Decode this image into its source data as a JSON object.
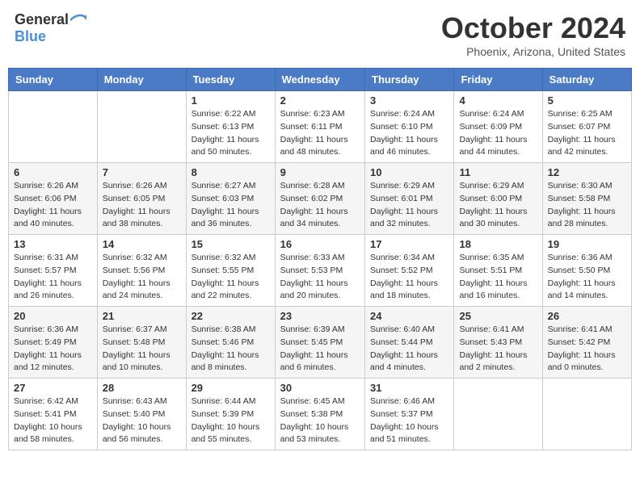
{
  "header": {
    "logo_general": "General",
    "logo_blue": "Blue",
    "month_title": "October 2024",
    "location": "Phoenix, Arizona, United States"
  },
  "weekdays": [
    "Sunday",
    "Monday",
    "Tuesday",
    "Wednesday",
    "Thursday",
    "Friday",
    "Saturday"
  ],
  "weeks": [
    [
      {
        "day": "",
        "sunrise": "",
        "sunset": "",
        "daylight": ""
      },
      {
        "day": "",
        "sunrise": "",
        "sunset": "",
        "daylight": ""
      },
      {
        "day": "1",
        "sunrise": "Sunrise: 6:22 AM",
        "sunset": "Sunset: 6:13 PM",
        "daylight": "Daylight: 11 hours and 50 minutes."
      },
      {
        "day": "2",
        "sunrise": "Sunrise: 6:23 AM",
        "sunset": "Sunset: 6:11 PM",
        "daylight": "Daylight: 11 hours and 48 minutes."
      },
      {
        "day": "3",
        "sunrise": "Sunrise: 6:24 AM",
        "sunset": "Sunset: 6:10 PM",
        "daylight": "Daylight: 11 hours and 46 minutes."
      },
      {
        "day": "4",
        "sunrise": "Sunrise: 6:24 AM",
        "sunset": "Sunset: 6:09 PM",
        "daylight": "Daylight: 11 hours and 44 minutes."
      },
      {
        "day": "5",
        "sunrise": "Sunrise: 6:25 AM",
        "sunset": "Sunset: 6:07 PM",
        "daylight": "Daylight: 11 hours and 42 minutes."
      }
    ],
    [
      {
        "day": "6",
        "sunrise": "Sunrise: 6:26 AM",
        "sunset": "Sunset: 6:06 PM",
        "daylight": "Daylight: 11 hours and 40 minutes."
      },
      {
        "day": "7",
        "sunrise": "Sunrise: 6:26 AM",
        "sunset": "Sunset: 6:05 PM",
        "daylight": "Daylight: 11 hours and 38 minutes."
      },
      {
        "day": "8",
        "sunrise": "Sunrise: 6:27 AM",
        "sunset": "Sunset: 6:03 PM",
        "daylight": "Daylight: 11 hours and 36 minutes."
      },
      {
        "day": "9",
        "sunrise": "Sunrise: 6:28 AM",
        "sunset": "Sunset: 6:02 PM",
        "daylight": "Daylight: 11 hours and 34 minutes."
      },
      {
        "day": "10",
        "sunrise": "Sunrise: 6:29 AM",
        "sunset": "Sunset: 6:01 PM",
        "daylight": "Daylight: 11 hours and 32 minutes."
      },
      {
        "day": "11",
        "sunrise": "Sunrise: 6:29 AM",
        "sunset": "Sunset: 6:00 PM",
        "daylight": "Daylight: 11 hours and 30 minutes."
      },
      {
        "day": "12",
        "sunrise": "Sunrise: 6:30 AM",
        "sunset": "Sunset: 5:58 PM",
        "daylight": "Daylight: 11 hours and 28 minutes."
      }
    ],
    [
      {
        "day": "13",
        "sunrise": "Sunrise: 6:31 AM",
        "sunset": "Sunset: 5:57 PM",
        "daylight": "Daylight: 11 hours and 26 minutes."
      },
      {
        "day": "14",
        "sunrise": "Sunrise: 6:32 AM",
        "sunset": "Sunset: 5:56 PM",
        "daylight": "Daylight: 11 hours and 24 minutes."
      },
      {
        "day": "15",
        "sunrise": "Sunrise: 6:32 AM",
        "sunset": "Sunset: 5:55 PM",
        "daylight": "Daylight: 11 hours and 22 minutes."
      },
      {
        "day": "16",
        "sunrise": "Sunrise: 6:33 AM",
        "sunset": "Sunset: 5:53 PM",
        "daylight": "Daylight: 11 hours and 20 minutes."
      },
      {
        "day": "17",
        "sunrise": "Sunrise: 6:34 AM",
        "sunset": "Sunset: 5:52 PM",
        "daylight": "Daylight: 11 hours and 18 minutes."
      },
      {
        "day": "18",
        "sunrise": "Sunrise: 6:35 AM",
        "sunset": "Sunset: 5:51 PM",
        "daylight": "Daylight: 11 hours and 16 minutes."
      },
      {
        "day": "19",
        "sunrise": "Sunrise: 6:36 AM",
        "sunset": "Sunset: 5:50 PM",
        "daylight": "Daylight: 11 hours and 14 minutes."
      }
    ],
    [
      {
        "day": "20",
        "sunrise": "Sunrise: 6:36 AM",
        "sunset": "Sunset: 5:49 PM",
        "daylight": "Daylight: 11 hours and 12 minutes."
      },
      {
        "day": "21",
        "sunrise": "Sunrise: 6:37 AM",
        "sunset": "Sunset: 5:48 PM",
        "daylight": "Daylight: 11 hours and 10 minutes."
      },
      {
        "day": "22",
        "sunrise": "Sunrise: 6:38 AM",
        "sunset": "Sunset: 5:46 PM",
        "daylight": "Daylight: 11 hours and 8 minutes."
      },
      {
        "day": "23",
        "sunrise": "Sunrise: 6:39 AM",
        "sunset": "Sunset: 5:45 PM",
        "daylight": "Daylight: 11 hours and 6 minutes."
      },
      {
        "day": "24",
        "sunrise": "Sunrise: 6:40 AM",
        "sunset": "Sunset: 5:44 PM",
        "daylight": "Daylight: 11 hours and 4 minutes."
      },
      {
        "day": "25",
        "sunrise": "Sunrise: 6:41 AM",
        "sunset": "Sunset: 5:43 PM",
        "daylight": "Daylight: 11 hours and 2 minutes."
      },
      {
        "day": "26",
        "sunrise": "Sunrise: 6:41 AM",
        "sunset": "Sunset: 5:42 PM",
        "daylight": "Daylight: 11 hours and 0 minutes."
      }
    ],
    [
      {
        "day": "27",
        "sunrise": "Sunrise: 6:42 AM",
        "sunset": "Sunset: 5:41 PM",
        "daylight": "Daylight: 10 hours and 58 minutes."
      },
      {
        "day": "28",
        "sunrise": "Sunrise: 6:43 AM",
        "sunset": "Sunset: 5:40 PM",
        "daylight": "Daylight: 10 hours and 56 minutes."
      },
      {
        "day": "29",
        "sunrise": "Sunrise: 6:44 AM",
        "sunset": "Sunset: 5:39 PM",
        "daylight": "Daylight: 10 hours and 55 minutes."
      },
      {
        "day": "30",
        "sunrise": "Sunrise: 6:45 AM",
        "sunset": "Sunset: 5:38 PM",
        "daylight": "Daylight: 10 hours and 53 minutes."
      },
      {
        "day": "31",
        "sunrise": "Sunrise: 6:46 AM",
        "sunset": "Sunset: 5:37 PM",
        "daylight": "Daylight: 10 hours and 51 minutes."
      },
      {
        "day": "",
        "sunrise": "",
        "sunset": "",
        "daylight": ""
      },
      {
        "day": "",
        "sunrise": "",
        "sunset": "",
        "daylight": ""
      }
    ]
  ]
}
